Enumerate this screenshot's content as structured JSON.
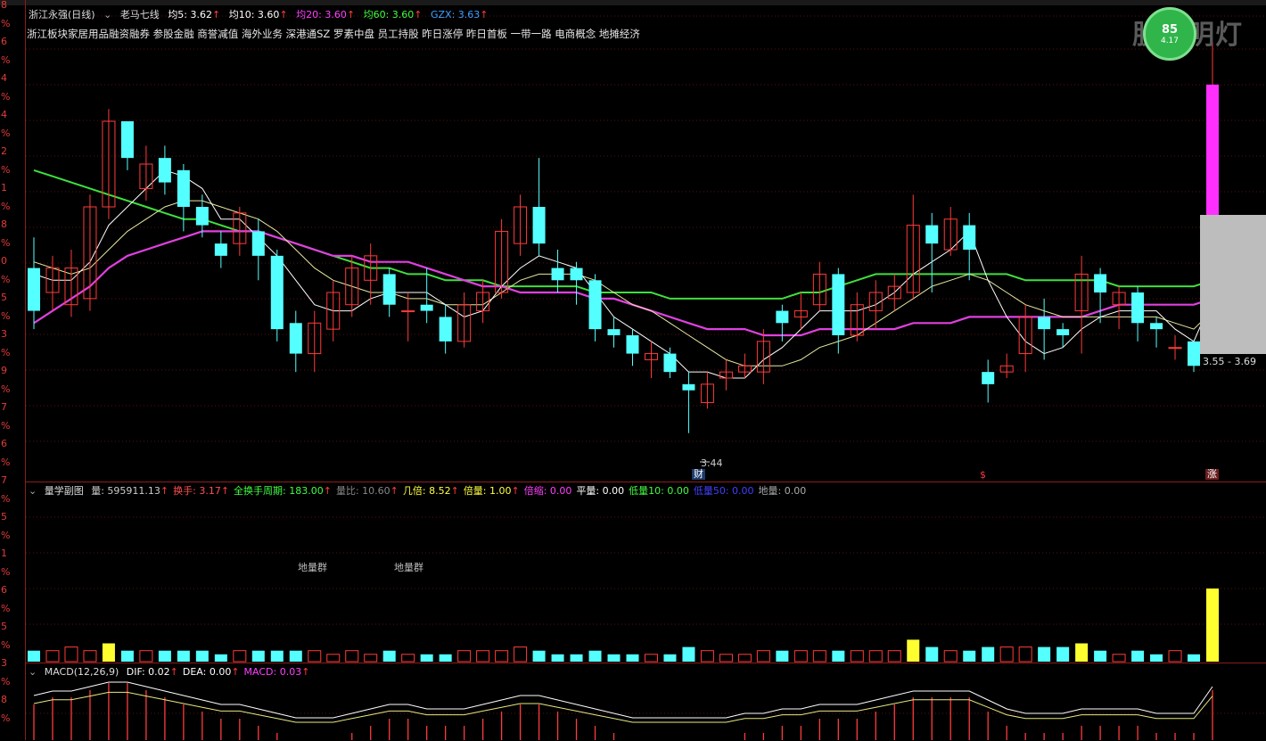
{
  "stock": {
    "title": "浙江永强(日线)",
    "study": "老马七线"
  },
  "ma": [
    {
      "label": "均5: 3.62",
      "color": "#ffffff"
    },
    {
      "label": "均10: 3.60",
      "color": "#ffffff"
    },
    {
      "label": "均20: 3.60",
      "color": "#ff40ff"
    },
    {
      "label": "均60: 3.60",
      "color": "#40ff40"
    },
    {
      "label": "GZX: 3.63",
      "color": "#40a0ff"
    }
  ],
  "concepts": "浙江板块家居用品融资融券 参股金融 商誉减值 海外业务 深港通SZ 罗素中盘 员工持股 昨日涨停 昨日首板 一带一路 电商概念 地摊经济",
  "watermark": "股海明灯",
  "logo": {
    "main": "85",
    "sub": "4.17"
  },
  "left_axis": [
    "8",
    "%",
    "6",
    "%",
    "4",
    "%",
    "4",
    "%",
    "2",
    "%",
    "1",
    "%",
    "8",
    "%",
    "0",
    "%",
    "5",
    "%",
    "3",
    "%",
    "9",
    "%",
    "7",
    "%",
    "6",
    "%",
    "7",
    "%",
    "5",
    "%",
    "1",
    "%",
    "6",
    "%",
    "5",
    "%",
    "3",
    "%",
    "8",
    "%"
  ],
  "range_label": "3.55 - 3.69",
  "low_label": "3.44",
  "markers": {
    "cai": "财",
    "s": "$",
    "zhang": "涨"
  },
  "volume": {
    "title": "量学副图",
    "items": [
      {
        "label": "量: 595911.13",
        "color": "#cccccc"
      },
      {
        "label": "换手: 3.17",
        "color": "#ff5050"
      },
      {
        "label": "全换手周期: 183.00",
        "color": "#40ff40"
      },
      {
        "label": "量比: 10.60",
        "color": "#888888"
      },
      {
        "label": "几倍: 8.52",
        "color": "#ffff40"
      },
      {
        "label": "倍量: 1.00",
        "color": "#ffff40"
      },
      {
        "label": "倍缩: 0.00",
        "color": "#ff40ff"
      },
      {
        "label": "平量: 0.00",
        "color": "#ffffff"
      },
      {
        "label": "低量10: 0.00",
        "color": "#40ff40"
      },
      {
        "label": "低量50: 0.00",
        "color": "#4040ff"
      },
      {
        "label": "地量: 0.00",
        "color": "#aaaaaa"
      }
    ],
    "note": "地量群"
  },
  "macd": {
    "title": "MACD(12,26,9)",
    "items": [
      {
        "label": "DIF: 0.02",
        "color": "#ffffff"
      },
      {
        "label": "DEA: 0.00",
        "color": "#ffffff"
      },
      {
        "label": "MACD: 0.03",
        "color": "#ff40ff"
      }
    ]
  },
  "colors": {
    "up": "#ff3b3b",
    "down": "#54ffff",
    "grid": "#8a1d1d"
  },
  "candles": [
    [
      3.62,
      3.55,
      3.67,
      3.52
    ],
    [
      3.58,
      3.62,
      3.64,
      3.55
    ],
    [
      3.56,
      3.62,
      3.65,
      3.54
    ],
    [
      3.57,
      3.72,
      3.74,
      3.55
    ],
    [
      3.72,
      3.86,
      3.88,
      3.7
    ],
    [
      3.86,
      3.8,
      3.86,
      3.78
    ],
    [
      3.75,
      3.79,
      3.82,
      3.73
    ],
    [
      3.8,
      3.76,
      3.82,
      3.74
    ],
    [
      3.78,
      3.72,
      3.79,
      3.68
    ],
    [
      3.72,
      3.69,
      3.74,
      3.67
    ],
    [
      3.66,
      3.64,
      3.68,
      3.62
    ],
    [
      3.66,
      3.71,
      3.72,
      3.64
    ],
    [
      3.68,
      3.64,
      3.7,
      3.6
    ],
    [
      3.64,
      3.52,
      3.65,
      3.5
    ],
    [
      3.53,
      3.48,
      3.55,
      3.45
    ],
    [
      3.48,
      3.53,
      3.55,
      3.45
    ],
    [
      3.52,
      3.58,
      3.6,
      3.5
    ],
    [
      3.56,
      3.62,
      3.64,
      3.54
    ],
    [
      3.6,
      3.64,
      3.66,
      3.56
    ],
    [
      3.61,
      3.56,
      3.62,
      3.54
    ],
    [
      3.55,
      3.55,
      3.58,
      3.5
    ],
    [
      3.56,
      3.55,
      3.62,
      3.53
    ],
    [
      3.54,
      3.5,
      3.56,
      3.48
    ],
    [
      3.5,
      3.56,
      3.58,
      3.49
    ],
    [
      3.55,
      3.58,
      3.6,
      3.53
    ],
    [
      3.58,
      3.68,
      3.7,
      3.57
    ],
    [
      3.66,
      3.72,
      3.74,
      3.64
    ],
    [
      3.72,
      3.66,
      3.8,
      3.64
    ],
    [
      3.62,
      3.6,
      3.65,
      3.58
    ],
    [
      3.62,
      3.6,
      3.63,
      3.56
    ],
    [
      3.6,
      3.52,
      3.61,
      3.5
    ],
    [
      3.52,
      3.51,
      3.54,
      3.49
    ],
    [
      3.51,
      3.48,
      3.52,
      3.46
    ],
    [
      3.47,
      3.48,
      3.5,
      3.44
    ],
    [
      3.48,
      3.45,
      3.49,
      3.44
    ],
    [
      3.43,
      3.42,
      3.45,
      3.35
    ],
    [
      3.4,
      3.43,
      3.45,
      3.39
    ],
    [
      3.44,
      3.45,
      3.47,
      3.42
    ],
    [
      3.45,
      3.46,
      3.48,
      3.44
    ],
    [
      3.45,
      3.5,
      3.52,
      3.43
    ],
    [
      3.55,
      3.53,
      3.56,
      3.5
    ],
    [
      3.54,
      3.55,
      3.58,
      3.52
    ],
    [
      3.56,
      3.61,
      3.63,
      3.55
    ],
    [
      3.61,
      3.51,
      3.62,
      3.48
    ],
    [
      3.51,
      3.56,
      3.58,
      3.5
    ],
    [
      3.55,
      3.58,
      3.6,
      3.52
    ],
    [
      3.57,
      3.59,
      3.61,
      3.55
    ],
    [
      3.58,
      3.69,
      3.74,
      3.57
    ],
    [
      3.69,
      3.66,
      3.71,
      3.58
    ],
    [
      3.65,
      3.7,
      3.72,
      3.64
    ],
    [
      3.69,
      3.65,
      3.71,
      3.6
    ],
    [
      3.45,
      3.43,
      3.47,
      3.4
    ],
    [
      3.45,
      3.46,
      3.48,
      3.44
    ],
    [
      3.48,
      3.54,
      3.56,
      3.45
    ],
    [
      3.54,
      3.52,
      3.57,
      3.47
    ],
    [
      3.52,
      3.51,
      3.53,
      3.49
    ],
    [
      3.55,
      3.61,
      3.64,
      3.48
    ],
    [
      3.61,
      3.58,
      3.62,
      3.53
    ],
    [
      3.56,
      3.58,
      3.59,
      3.52
    ],
    [
      3.58,
      3.53,
      3.59,
      3.5
    ],
    [
      3.53,
      3.52,
      3.54,
      3.49
    ],
    [
      3.49,
      3.49,
      3.51,
      3.47
    ],
    [
      3.5,
      3.46,
      3.5,
      3.45
    ],
    [
      3.5,
      3.92,
      3.99,
      3.5
    ]
  ],
  "ma_lines": {
    "ma5": [
      3.61,
      3.6,
      3.6,
      3.63,
      3.69,
      3.72,
      3.75,
      3.78,
      3.77,
      3.75,
      3.7,
      3.7,
      3.67,
      3.64,
      3.6,
      3.56,
      3.55,
      3.55,
      3.57,
      3.58,
      3.58,
      3.58,
      3.56,
      3.54,
      3.55,
      3.59,
      3.62,
      3.64,
      3.63,
      3.62,
      3.58,
      3.54,
      3.52,
      3.5,
      3.48,
      3.45,
      3.45,
      3.44,
      3.44,
      3.47,
      3.49,
      3.52,
      3.55,
      3.55,
      3.55,
      3.56,
      3.58,
      3.61,
      3.63,
      3.65,
      3.68,
      3.6,
      3.54,
      3.5,
      3.48,
      3.49,
      3.52,
      3.54,
      3.55,
      3.55,
      3.55,
      3.52,
      3.5,
      3.57
    ],
    "ma10": [
      3.63,
      3.62,
      3.61,
      3.62,
      3.65,
      3.68,
      3.7,
      3.72,
      3.73,
      3.73,
      3.72,
      3.71,
      3.7,
      3.68,
      3.65,
      3.62,
      3.6,
      3.59,
      3.58,
      3.58,
      3.57,
      3.57,
      3.56,
      3.56,
      3.56,
      3.58,
      3.6,
      3.61,
      3.61,
      3.61,
      3.6,
      3.58,
      3.56,
      3.55,
      3.53,
      3.51,
      3.49,
      3.47,
      3.46,
      3.46,
      3.46,
      3.47,
      3.49,
      3.5,
      3.51,
      3.53,
      3.55,
      3.57,
      3.59,
      3.6,
      3.61,
      3.6,
      3.58,
      3.56,
      3.55,
      3.54,
      3.54,
      3.54,
      3.54,
      3.54,
      3.54,
      3.53,
      3.52,
      3.55
    ],
    "ma20": [
      3.53,
      3.55,
      3.57,
      3.59,
      3.62,
      3.64,
      3.65,
      3.66,
      3.67,
      3.68,
      3.68,
      3.68,
      3.68,
      3.67,
      3.66,
      3.65,
      3.64,
      3.64,
      3.63,
      3.63,
      3.63,
      3.62,
      3.61,
      3.6,
      3.59,
      3.59,
      3.58,
      3.58,
      3.58,
      3.58,
      3.57,
      3.57,
      3.56,
      3.55,
      3.54,
      3.53,
      3.52,
      3.52,
      3.52,
      3.51,
      3.51,
      3.51,
      3.52,
      3.52,
      3.52,
      3.52,
      3.52,
      3.53,
      3.53,
      3.53,
      3.54,
      3.54,
      3.54,
      3.54,
      3.54,
      3.54,
      3.54,
      3.55,
      3.56,
      3.56,
      3.56,
      3.56,
      3.56,
      3.57
    ],
    "ma60": [
      3.78,
      3.77,
      3.76,
      3.75,
      3.74,
      3.73,
      3.72,
      3.71,
      3.7,
      3.7,
      3.69,
      3.68,
      3.68,
      3.67,
      3.66,
      3.65,
      3.64,
      3.63,
      3.62,
      3.62,
      3.61,
      3.61,
      3.6,
      3.6,
      3.6,
      3.59,
      3.59,
      3.59,
      3.59,
      3.59,
      3.58,
      3.58,
      3.58,
      3.58,
      3.57,
      3.57,
      3.57,
      3.57,
      3.57,
      3.57,
      3.57,
      3.58,
      3.58,
      3.59,
      3.6,
      3.61,
      3.61,
      3.61,
      3.61,
      3.61,
      3.61,
      3.61,
      3.61,
      3.6,
      3.6,
      3.6,
      3.6,
      3.6,
      3.59,
      3.59,
      3.59,
      3.59,
      3.59,
      3.6
    ]
  },
  "vols": [
    3,
    3,
    4,
    3,
    5,
    3,
    3,
    3,
    3,
    3,
    2,
    3,
    3,
    3,
    3,
    3,
    2,
    3,
    2,
    3,
    2,
    2,
    2,
    3,
    3,
    3,
    4,
    3,
    2,
    2,
    3,
    2,
    2,
    2,
    2,
    4,
    3,
    2,
    2,
    3,
    3,
    3,
    3,
    3,
    3,
    3,
    3,
    6,
    4,
    3,
    3,
    4,
    4,
    4,
    4,
    4,
    5,
    3,
    2,
    3,
    2,
    3,
    2,
    20
  ],
  "macd_bars": [
    0.05,
    0.06,
    0.06,
    0.07,
    0.08,
    0.08,
    0.07,
    0.06,
    0.05,
    0.04,
    0.03,
    0.03,
    0.02,
    0.01,
    0.0,
    0.0,
    0.0,
    0.01,
    0.02,
    0.03,
    0.03,
    0.02,
    0.02,
    0.02,
    0.03,
    0.04,
    0.05,
    0.05,
    0.04,
    0.03,
    0.02,
    0.01,
    0.0,
    0.0,
    0.0,
    0.0,
    0.0,
    0.0,
    0.01,
    0.01,
    0.02,
    0.02,
    0.03,
    0.03,
    0.03,
    0.04,
    0.05,
    0.06,
    0.06,
    0.06,
    0.06,
    0.04,
    0.02,
    0.01,
    0.01,
    0.01,
    0.02,
    0.02,
    0.02,
    0.02,
    0.01,
    0.01,
    0.01,
    0.07
  ]
}
